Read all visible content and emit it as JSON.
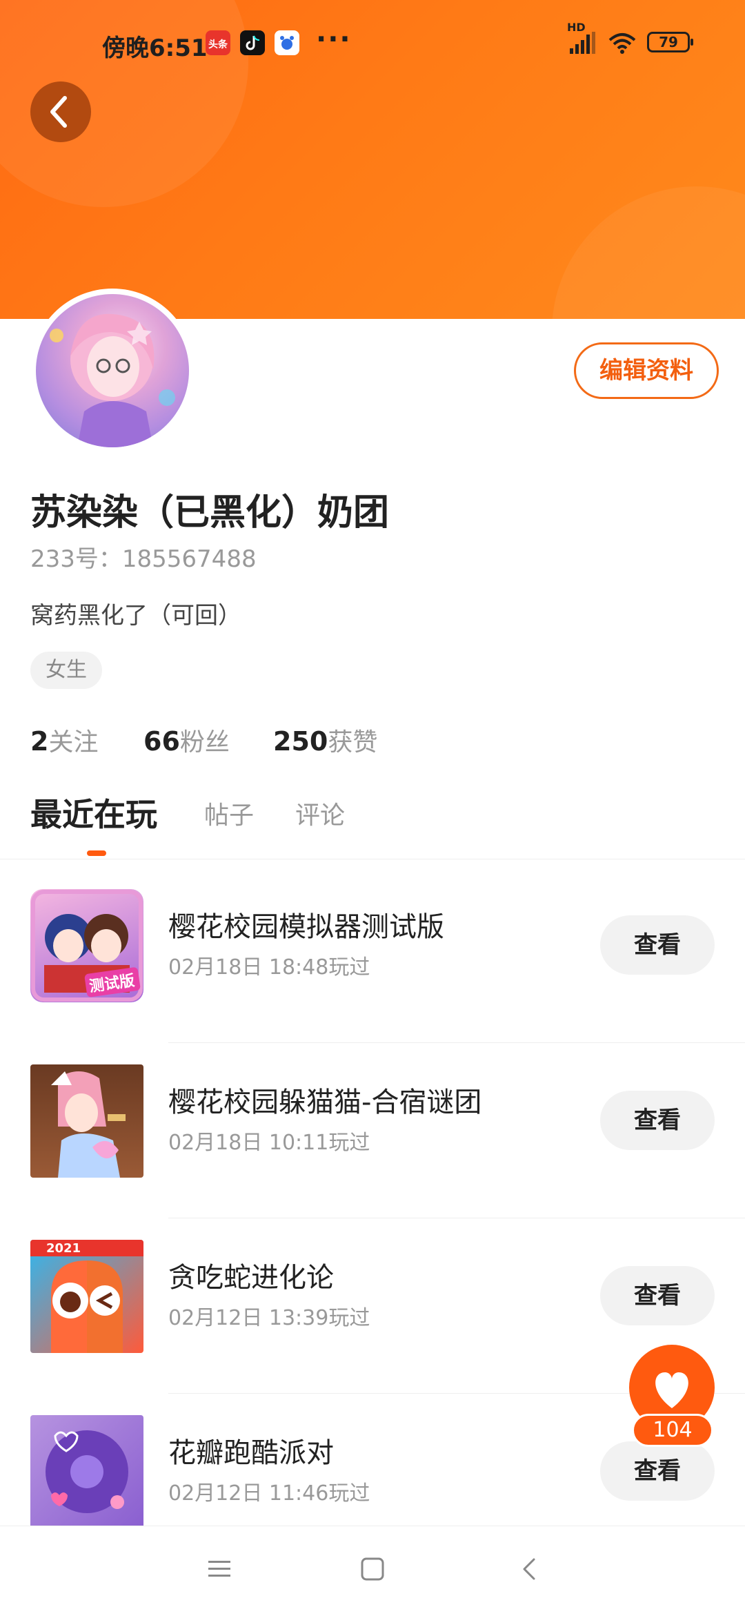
{
  "status_bar": {
    "time": "傍晚6:51",
    "app_icons": [
      "toutiao-icon",
      "tiktok-icon",
      "baidu-icon"
    ],
    "more": "···",
    "signal_label": "HD",
    "battery": "79"
  },
  "profile": {
    "edit_button": "编辑资料",
    "name": "苏染染（已黑化）奶团",
    "uid": "233号：185567488",
    "bio": "窝药黑化了（可回）",
    "gender_tag": "女生",
    "stats": [
      {
        "count": "2",
        "label": "关注"
      },
      {
        "count": "66",
        "label": "粉丝"
      },
      {
        "count": "250",
        "label": "获赞"
      }
    ]
  },
  "tabs": [
    {
      "label": "最近在玩",
      "active": true
    },
    {
      "label": "帖子",
      "active": false
    },
    {
      "label": "评论",
      "active": false
    }
  ],
  "games": [
    {
      "title": "樱花校园模拟器测试版",
      "played": "02月18日 18:48玩过",
      "action": "查看",
      "thumb_badge": "测试版"
    },
    {
      "title": "樱花校园躲猫猫-合宿谜团",
      "played": "02月18日 10:11玩过",
      "action": "查看"
    },
    {
      "title": "贪吃蛇进化论",
      "played": "02月12日 13:39玩过",
      "action": "查看",
      "thumb_badge": "2021"
    },
    {
      "title": "花瓣跑酷派对",
      "played": "02月12日 11:46玩过",
      "action": "查看"
    }
  ],
  "fab": {
    "count": "104"
  },
  "colors": {
    "accent": "#ff5a0f",
    "header": "#ff7a16"
  }
}
